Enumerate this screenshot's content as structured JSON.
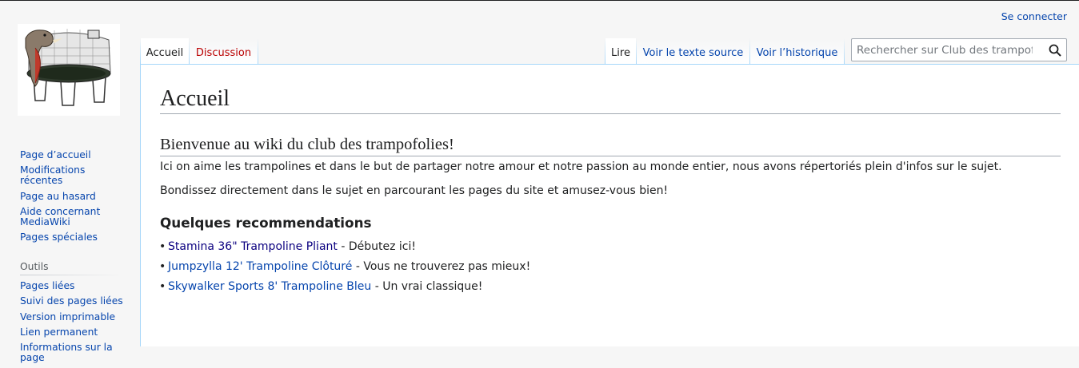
{
  "personal": {
    "login_label": "Se connecter"
  },
  "logo": {
    "alt": "Club des trampofolies"
  },
  "tabs": {
    "left": [
      {
        "label": "Accueil",
        "selected": true
      },
      {
        "label": "Discussion",
        "selected": false,
        "new": true
      }
    ],
    "right": [
      {
        "label": "Lire",
        "selected": true
      },
      {
        "label": "Voir le texte source",
        "selected": false
      },
      {
        "label": "Voir l’historique",
        "selected": false
      }
    ]
  },
  "search": {
    "placeholder": "Rechercher sur Club des trampofolies",
    "value": ""
  },
  "navigation": {
    "items": [
      "Page d’accueil",
      "Modifications récentes",
      "Page au hasard",
      "Aide concernant MediaWiki",
      "Pages spéciales"
    ]
  },
  "tools": {
    "heading": "Outils",
    "items": [
      "Pages liées",
      "Suivi des pages liées",
      "Version imprimable",
      "Lien permanent",
      "Informations sur la page"
    ]
  },
  "content": {
    "title": "Accueil",
    "section_heading": "Bienvenue au wiki du club des trampofolies!",
    "paragraph_1": "Ici on aime les trampolines et dans le but de partager notre amour et notre passion au monde entier, nous avons répertoriés plein d'infos sur le sujet.",
    "paragraph_2": "Bondissez directement dans le sujet en parcourant les pages du site et amusez-vous bien!",
    "subheading": "Quelques recommendations",
    "recommendations": [
      {
        "link": "Stamina 36\" Trampoline Pliant",
        "text": " - Débutez ici!",
        "visited": true
      },
      {
        "link": "Jumpzylla 12' Trampoline Clôturé",
        "text": " - Vous ne trouverez pas mieux!",
        "visited": false
      },
      {
        "link": "Skywalker Sports 8' Trampoline Bleu",
        "text": " - Un vrai classique!",
        "visited": false
      }
    ]
  },
  "colors": {
    "link": "#0645ad",
    "visited_link": "#0b0080",
    "new_link": "#ba0000",
    "border": "#a7d7f9"
  }
}
